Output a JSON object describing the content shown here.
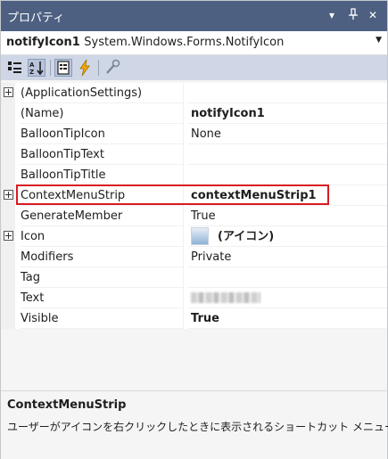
{
  "titlebar": {
    "title": "プロパティ",
    "dropdown_icon": "▾",
    "pin_icon": "ᛒ",
    "close_icon": "✕"
  },
  "object_selector": {
    "name": "notifyIcon1",
    "type": "System.Windows.Forms.NotifyIcon"
  },
  "toolbar": {
    "buttons": [
      "categorized-icon",
      "alphabetical-icon",
      "properties-icon",
      "events-icon",
      "property-pages-icon"
    ]
  },
  "properties": [
    {
      "name": "(ApplicationSettings)",
      "value": "",
      "expandable": true
    },
    {
      "name": "(Name)",
      "value": "notifyIcon1",
      "bold": true
    },
    {
      "name": "BalloonTipIcon",
      "value": "None"
    },
    {
      "name": "BalloonTipText",
      "value": ""
    },
    {
      "name": "BalloonTipTitle",
      "value": ""
    },
    {
      "name": "ContextMenuStrip",
      "value": "contextMenuStrip1",
      "bold": true,
      "expandable": true
    },
    {
      "name": "GenerateMember",
      "value": "True"
    },
    {
      "name": "Icon",
      "value": "(アイコン)",
      "bold": true,
      "expandable": true
    },
    {
      "name": "Modifiers",
      "value": "Private"
    },
    {
      "name": "Tag",
      "value": ""
    },
    {
      "name": "Text",
      "value": ""
    },
    {
      "name": "Visible",
      "value": "True",
      "bold": true
    }
  ],
  "description": {
    "title": "ContextMenuStrip",
    "text": "ユーザーがアイコンを右クリックしたときに表示されるショートカット メニュー..."
  },
  "colors": {
    "titlebar": "#4d6082",
    "toolbar": "#cfd6e5",
    "highlight": "#d81b23"
  }
}
